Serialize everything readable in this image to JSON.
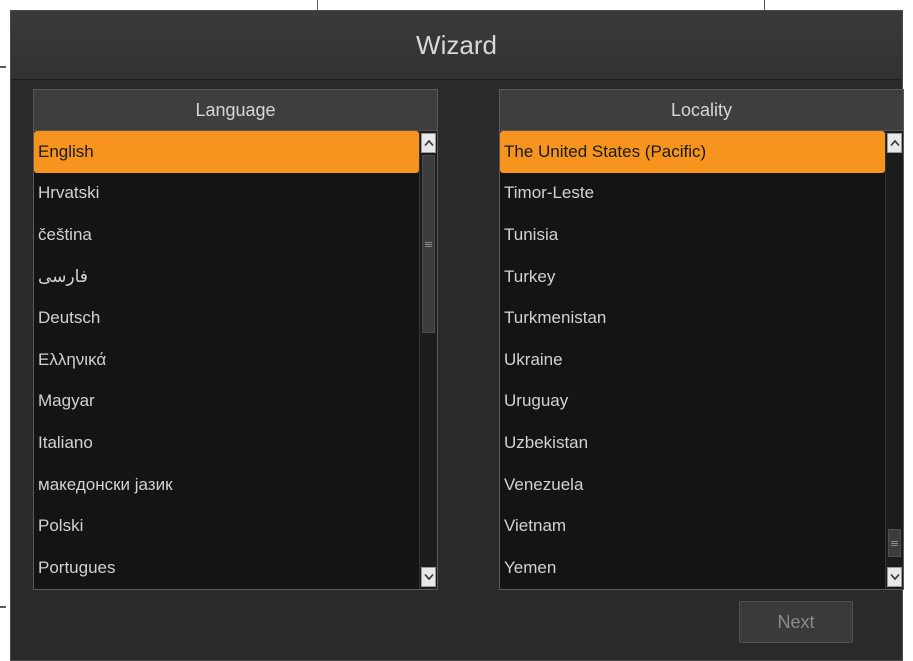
{
  "window": {
    "title": "Wizard"
  },
  "language_panel": {
    "header": "Language",
    "items": [
      {
        "label": "English",
        "selected": true
      },
      {
        "label": "Hrvatski",
        "selected": false
      },
      {
        "label": "čeština",
        "selected": false
      },
      {
        "label": "فارسی",
        "selected": false
      },
      {
        "label": "Deutsch",
        "selected": false
      },
      {
        "label": "Ελληνικά",
        "selected": false
      },
      {
        "label": "Magyar",
        "selected": false
      },
      {
        "label": "Italiano",
        "selected": false
      },
      {
        "label": "македонски јазик",
        "selected": false
      },
      {
        "label": "Polski",
        "selected": false
      },
      {
        "label": "Portugues",
        "selected": false
      }
    ]
  },
  "locality_panel": {
    "header": "Locality",
    "items": [
      {
        "label": "The United States (Pacific)",
        "selected": true
      },
      {
        "label": "Timor-Leste",
        "selected": false
      },
      {
        "label": "Tunisia",
        "selected": false
      },
      {
        "label": "Turkey",
        "selected": false
      },
      {
        "label": "Turkmenistan",
        "selected": false
      },
      {
        "label": "Ukraine",
        "selected": false
      },
      {
        "label": "Uruguay",
        "selected": false
      },
      {
        "label": "Uzbekistan",
        "selected": false
      },
      {
        "label": "Venezuela",
        "selected": false
      },
      {
        "label": "Vietnam",
        "selected": false
      },
      {
        "label": "Yemen",
        "selected": false
      }
    ]
  },
  "footer": {
    "next_label": "Next"
  },
  "colors": {
    "selection": "#f7941d",
    "background": "#2a2a2a"
  },
  "icons": {
    "scroll_up": "chevron-up-icon",
    "scroll_down": "chevron-down-icon",
    "thumb_grip": "grip-lines-icon"
  }
}
